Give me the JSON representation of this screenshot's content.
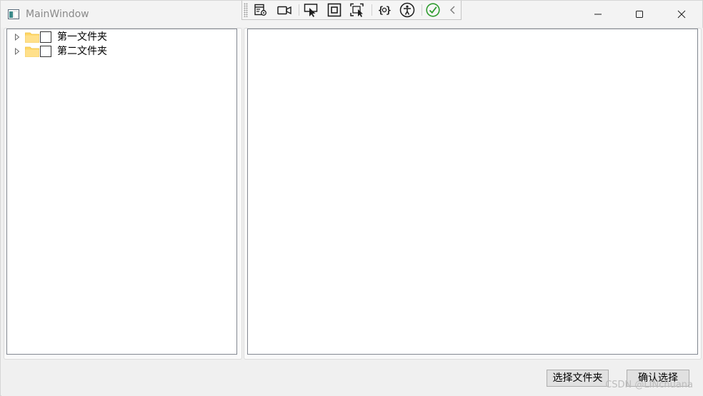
{
  "window": {
    "title": "MainWindow"
  },
  "devtools": {
    "icons": [
      "live-visual-tree-icon",
      "record-icon",
      "select-element-icon",
      "display-layout-adorners-icon",
      "track-focus-icon",
      "binding-failures-icon",
      "accessibility-icon",
      "hot-reload-ok-icon",
      "collapse-icon"
    ]
  },
  "tree": {
    "items": [
      {
        "label": "第一文件夹",
        "checked": false,
        "expanded": false
      },
      {
        "label": "第二文件夹",
        "checked": false,
        "expanded": false
      }
    ]
  },
  "buttons": {
    "select_folder": "选择文件夹",
    "confirm": "确认选择"
  },
  "watermark": "CSDN @LINchuana",
  "colors": {
    "folder": "#ffd765",
    "hot_reload_ok": "#2e9c2e",
    "panel_border": "#828790",
    "button_face": "#e1e1e1"
  }
}
